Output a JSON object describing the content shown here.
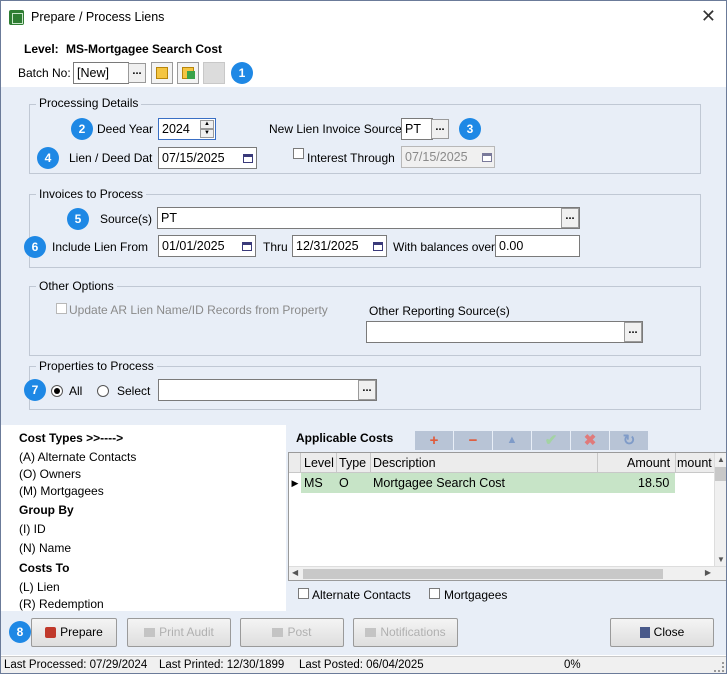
{
  "window": {
    "title": "Prepare / Process Liens",
    "close_glyph": "✕"
  },
  "header": {
    "level_label": "Level:",
    "level_value": "MS-Mortgagee Search Cost",
    "batch_label": "Batch No:",
    "batch_value": "[New]",
    "ellipsis": "..."
  },
  "badges": [
    "1",
    "2",
    "3",
    "4",
    "5",
    "6",
    "7",
    "8"
  ],
  "processing": {
    "title": "Processing Details",
    "deed_year_label": "Deed Year",
    "deed_year_value": "2024",
    "invoice_source_label": "New Lien Invoice Source",
    "invoice_source_value": "PT",
    "lien_date_label": "Lien / Deed Dat",
    "lien_date_value": "07/15/2025",
    "interest_label": "Interest Through",
    "interest_value": "07/15/2025",
    "interest_checked": false
  },
  "invoices": {
    "title": "Invoices to Process",
    "sources_label": "Source(s)",
    "sources_value": "PT",
    "include_label": "Include Lien From",
    "from_value": "01/01/2025",
    "thru_label": "Thru",
    "thru_value": "12/31/2025",
    "balance_label": "With balances over",
    "balance_value": "0.00"
  },
  "other": {
    "title": "Other Options",
    "update_label": "Update AR Lien Name/ID Records from Property",
    "update_checked": false,
    "reporting_label": "Other Reporting Source(s)",
    "reporting_value": ""
  },
  "properties": {
    "title": "Properties to Process",
    "all_label": "All",
    "select_label": "Select",
    "selected": "All",
    "select_value": ""
  },
  "legend": [
    {
      "text": "Cost Types >>---->",
      "bold": true
    },
    {
      "text": "(A) Alternate Contacts",
      "bold": false
    },
    {
      "text": "(O) Owners",
      "bold": false
    },
    {
      "text": "(M) Mortgagees",
      "bold": false
    },
    {
      "text": "Group By",
      "bold": true
    },
    {
      "text": "(I) ID",
      "bold": false
    },
    {
      "text": "(N) Name",
      "bold": false
    },
    {
      "text": "Costs To",
      "bold": true
    },
    {
      "text": "(L) Lien",
      "bold": false
    },
    {
      "text": "(R) Redemption",
      "bold": false
    }
  ],
  "costs": {
    "title": "Applicable Costs",
    "toolbar": [
      {
        "name": "add",
        "glyph": "+",
        "color": "#e05a3a"
      },
      {
        "name": "remove",
        "glyph": "−",
        "color": "#e05a3a"
      },
      {
        "name": "move-up",
        "glyph": "▲",
        "color": "#7f9bc8"
      },
      {
        "name": "accept",
        "glyph": "✔",
        "color": "#a3d3a3"
      },
      {
        "name": "cancel",
        "glyph": "✖",
        "color": "#e07a7a"
      },
      {
        "name": "refresh",
        "glyph": "↻",
        "color": "#7f9bc8"
      }
    ],
    "columns": [
      "Level",
      "Type",
      "Description",
      "Amount",
      "mount"
    ],
    "rows": [
      {
        "level": "MS",
        "type": "O",
        "description": "Mortgagee Search Cost",
        "amount": "18.50"
      }
    ],
    "alt_contacts_label": "Alternate Contacts",
    "mortgagees_label": "Mortgagees",
    "highlight_color": "#c7e4c7"
  },
  "buttons": {
    "prepare": "Prepare",
    "print_audit": "Print Audit",
    "post": "Post",
    "notifications": "Notifications",
    "close": "Close"
  },
  "status": {
    "last_processed": "Last Processed: 07/29/2024",
    "last_printed": "Last Printed: 12/30/1899",
    "last_posted": "Last Posted: 06/04/2025",
    "progress": "0%"
  },
  "colors": {
    "panel": "#e8eef7",
    "badge": "#1e88e5",
    "grid_header": "#ececec"
  }
}
